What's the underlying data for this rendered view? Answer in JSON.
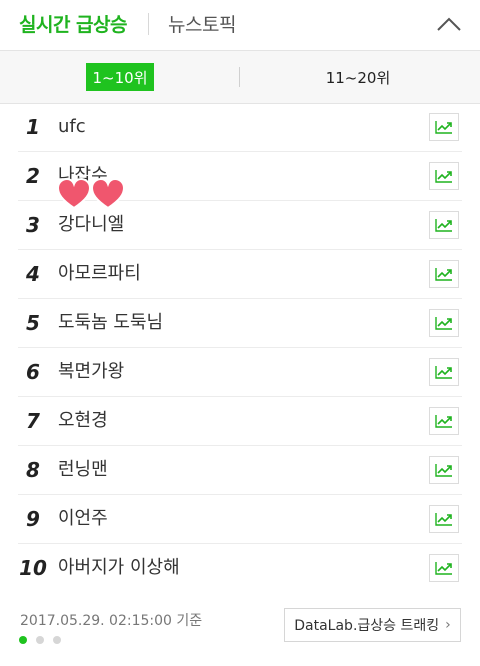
{
  "header": {
    "tab_realtime": "실시간 급상승",
    "tab_news": "뉴스토픽",
    "collapse_icon": "chevron-up-icon"
  },
  "subtabs": {
    "active_label": "1~10위",
    "inactive_label": "11~20위"
  },
  "list": [
    {
      "rank": "1",
      "keyword": "ufc"
    },
    {
      "rank": "2",
      "keyword": "나잡수"
    },
    {
      "rank": "3",
      "keyword": "강다니엘"
    },
    {
      "rank": "4",
      "keyword": "아모르파티"
    },
    {
      "rank": "5",
      "keyword": "도둑놈 도둑님"
    },
    {
      "rank": "6",
      "keyword": "복면가왕"
    },
    {
      "rank": "7",
      "keyword": "오현경"
    },
    {
      "rank": "8",
      "keyword": "런닝맨"
    },
    {
      "rank": "9",
      "keyword": "이언주"
    },
    {
      "rank": "10",
      "keyword": "아버지가 이상해"
    }
  ],
  "footer": {
    "timestamp": "2017.05.29. 02:15:00 기준",
    "datalab_label": "DataLab.급상승 트래킹",
    "pager_total": 3,
    "pager_active": 1
  },
  "colors": {
    "accent": "#1fc31f",
    "heart": "#f0566e"
  }
}
